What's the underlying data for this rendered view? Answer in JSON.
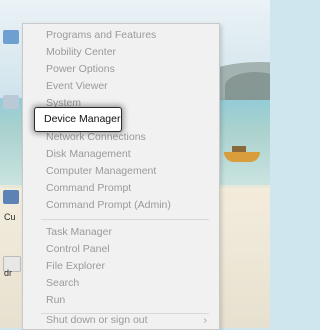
{
  "desktop": {
    "icon_labels": [
      "Cu",
      "dr"
    ]
  },
  "menu": {
    "group1": [
      {
        "label": "Programs and Features"
      },
      {
        "label": "Mobility Center"
      },
      {
        "label": "Power Options"
      },
      {
        "label": "Event Viewer"
      },
      {
        "label": "System"
      }
    ],
    "highlighted": {
      "label": "Device Manager"
    },
    "group1b": [
      {
        "label": "Network Connections"
      },
      {
        "label": "Disk Management"
      },
      {
        "label": "Computer Management"
      },
      {
        "label": "Command Prompt"
      },
      {
        "label": "Command Prompt (Admin)"
      }
    ],
    "group2": [
      {
        "label": "Task Manager"
      },
      {
        "label": "Control Panel"
      },
      {
        "label": "File Explorer"
      },
      {
        "label": "Search"
      },
      {
        "label": "Run"
      }
    ],
    "group3": [
      {
        "label": "Shut down or sign out"
      }
    ],
    "submenu_arrow": "›"
  }
}
